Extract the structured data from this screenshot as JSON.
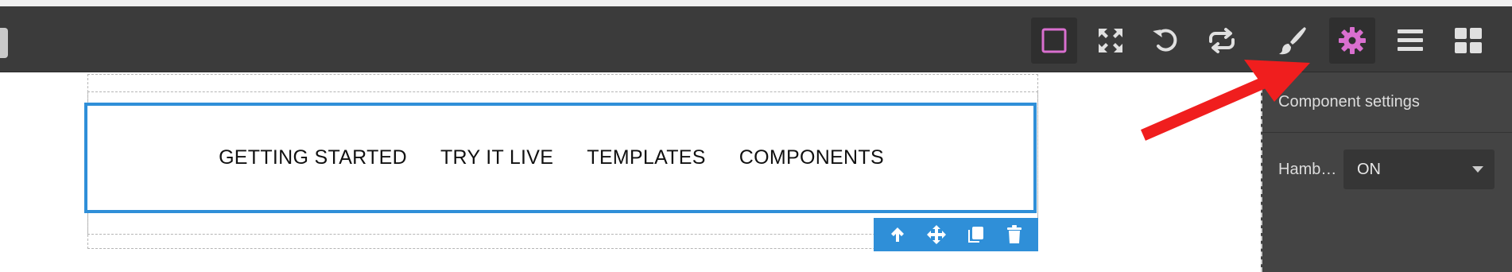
{
  "toolbar": {
    "left_stub_icon": "truncated-toolbar-icon",
    "buttons": [
      {
        "name": "sw-visibility-button",
        "icon": "square-outline-icon"
      },
      {
        "name": "fullscreen-button",
        "icon": "expand-arrows-icon"
      },
      {
        "name": "undo-button",
        "icon": "undo-icon"
      },
      {
        "name": "import-export-button",
        "icon": "repeat-arrows-icon"
      },
      {
        "name": "style-manager-button",
        "icon": "paintbrush-icon"
      },
      {
        "name": "trait-manager-button",
        "icon": "gear-icon",
        "active": true
      },
      {
        "name": "layer-manager-button",
        "icon": "bars-icon"
      },
      {
        "name": "blocks-button",
        "icon": "grid-icon"
      }
    ]
  },
  "canvas": {
    "nav_links": [
      "GETTING STARTED",
      "TRY IT LIVE",
      "TEMPLATES",
      "COMPONENTS"
    ],
    "component_toolbar": [
      "arrow-up-icon",
      "move-icon",
      "clone-icon",
      "trash-icon"
    ]
  },
  "panel": {
    "title": "Component settings",
    "setting_label": "Hamb…",
    "setting_value": "ON"
  },
  "colors": {
    "toolbar_bg": "#3b3b3b",
    "panel_bg": "#444444",
    "accent_pink": "#d96fcf",
    "selection_blue": "#2f8fd8",
    "annotation_red": "#f01e1e"
  }
}
